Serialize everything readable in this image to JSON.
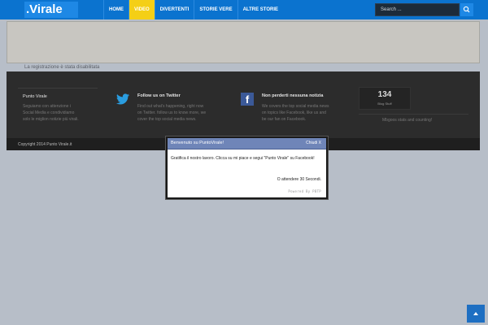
{
  "header": {
    "logo": ".Virale",
    "nav": [
      "HOME",
      "VIDEO",
      "DIVERTENTI",
      "STORIE VERE",
      "ALTRE STORIE"
    ],
    "active_nav_index": 1,
    "search_placeholder": "Search ...",
    "colors": {
      "bar": "#0b73cf",
      "active": "#f4cf16"
    }
  },
  "notice": "La registrazione è stata disabilitata",
  "footer": {
    "col1": {
      "title": "Punto Virale",
      "text": [
        "Seguiamo con attenzione i",
        "Social Media e condividiamo",
        "solo le miglion notizie più virali."
      ]
    },
    "col2": {
      "icon": "twitter-icon",
      "title": "Follow us on Twitter",
      "text": [
        "Find out what's happening, right now",
        "on Twitter. follow us to know more, we",
        "cover the top social media news."
      ]
    },
    "col3": {
      "icon": "facebook-icon",
      "title": "Non perderti nessuna notizia",
      "text": [
        "We covers the top social media news",
        "on topics like Facebook, like us and",
        "be our fan on Facebook."
      ]
    },
    "stats": {
      "count": "134",
      "label": "Blog Stuff",
      "tagline": "Mbgoos stats and counting!"
    },
    "copyright": "Copyright 2014 Punto Virale.it"
  },
  "popup": {
    "title": "Benvenuto su PuntoVirale!",
    "close": "Chiudi X",
    "message": "Gratifica il nostro lavoro. Clicca su mi piace e segui \"Punto Virale\" su Facebook!",
    "wait": "O attendere 30 Secondi.",
    "powered": "Powered By PBTP"
  }
}
